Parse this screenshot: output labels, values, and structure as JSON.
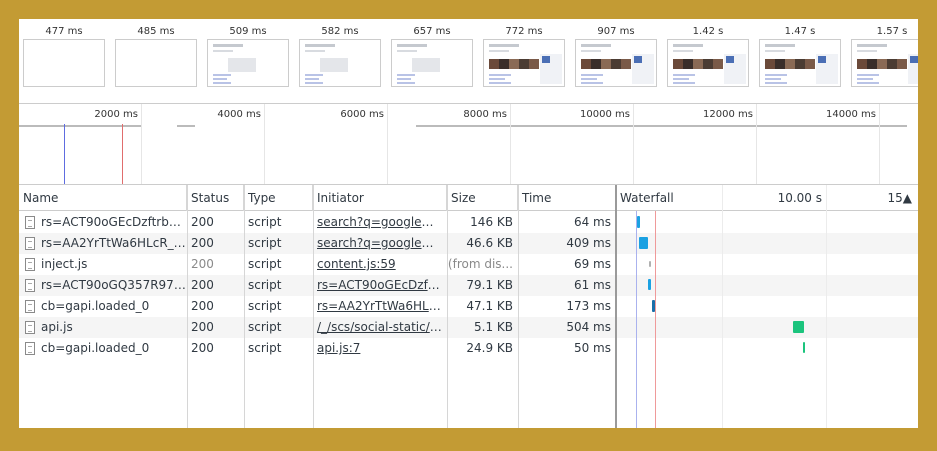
{
  "filmstrip": {
    "frames": [
      {
        "time": "477 ms",
        "state": "blank"
      },
      {
        "time": "485 ms",
        "state": "blank"
      },
      {
        "time": "509 ms",
        "state": "partial"
      },
      {
        "time": "582 ms",
        "state": "partial"
      },
      {
        "time": "657 ms",
        "state": "partial"
      },
      {
        "time": "772 ms",
        "state": "full"
      },
      {
        "time": "907 ms",
        "state": "full"
      },
      {
        "time": "1.42 s",
        "state": "full"
      },
      {
        "time": "1.47 s",
        "state": "full"
      },
      {
        "time": "1.57 s",
        "state": "full"
      }
    ]
  },
  "overview": {
    "ticks": [
      "2000 ms",
      "4000 ms",
      "6000 ms",
      "8000 ms",
      "10000 ms",
      "12000 ms",
      "14000 ms"
    ],
    "dom_content_loaded_color": "#5e6ce0",
    "load_color": "#e06d6d"
  },
  "grid": {
    "columns": {
      "name": "Name",
      "status": "Status",
      "type": "Type",
      "initiator": "Initiator",
      "size": "Size",
      "time": "Time",
      "waterfall": "Waterfall",
      "wf_tick1": "10.00 s",
      "wf_tick2": "15▲"
    },
    "rows": [
      {
        "name": "rs=ACT90oGEcDzftrb0...",
        "status": "200",
        "type": "script",
        "initiator": "search?q=google+n...",
        "size": "146 KB",
        "time": "64 ms",
        "status_dim": false,
        "size_dim": false,
        "wf_color": "#1ba1e2"
      },
      {
        "name": "rs=AA2YrTtWa6HLcR_y...",
        "status": "200",
        "type": "script",
        "initiator": "search?q=google+n...",
        "size": "46.6 KB",
        "time": "409 ms",
        "status_dim": false,
        "size_dim": false,
        "wf_color": "#1ba1e2"
      },
      {
        "name": "inject.js",
        "status": "200",
        "type": "script",
        "initiator": "content.js:59",
        "size": "(from dis...",
        "time": "69 ms",
        "status_dim": true,
        "size_dim": true,
        "wf_color": "#b0b0b0"
      },
      {
        "name": "rs=ACT90oGQ357R97y...",
        "status": "200",
        "type": "script",
        "initiator": "rs=ACT90oGEcDzftr...",
        "size": "79.1 KB",
        "time": "61 ms",
        "status_dim": false,
        "size_dim": false,
        "wf_color": "#1ba1e2"
      },
      {
        "name": "cb=gapi.loaded_0",
        "status": "200",
        "type": "script",
        "initiator": "rs=AA2YrTtWa6HLc...",
        "size": "47.1 KB",
        "time": "173 ms",
        "status_dim": false,
        "size_dim": false,
        "wf_color": "#1a6fa8"
      },
      {
        "name": "api.js",
        "status": "200",
        "type": "script",
        "initiator": "/_/scs/social-static/_...",
        "size": "5.1 KB",
        "time": "504 ms",
        "status_dim": false,
        "size_dim": false,
        "wf_color": "#1bc47d"
      },
      {
        "name": "cb=gapi.loaded_0",
        "status": "200",
        "type": "script",
        "initiator": "api.js:7",
        "size": "24.9 KB",
        "time": "50 ms",
        "status_dim": false,
        "size_dim": false,
        "wf_color": "#1bc47d"
      }
    ]
  }
}
